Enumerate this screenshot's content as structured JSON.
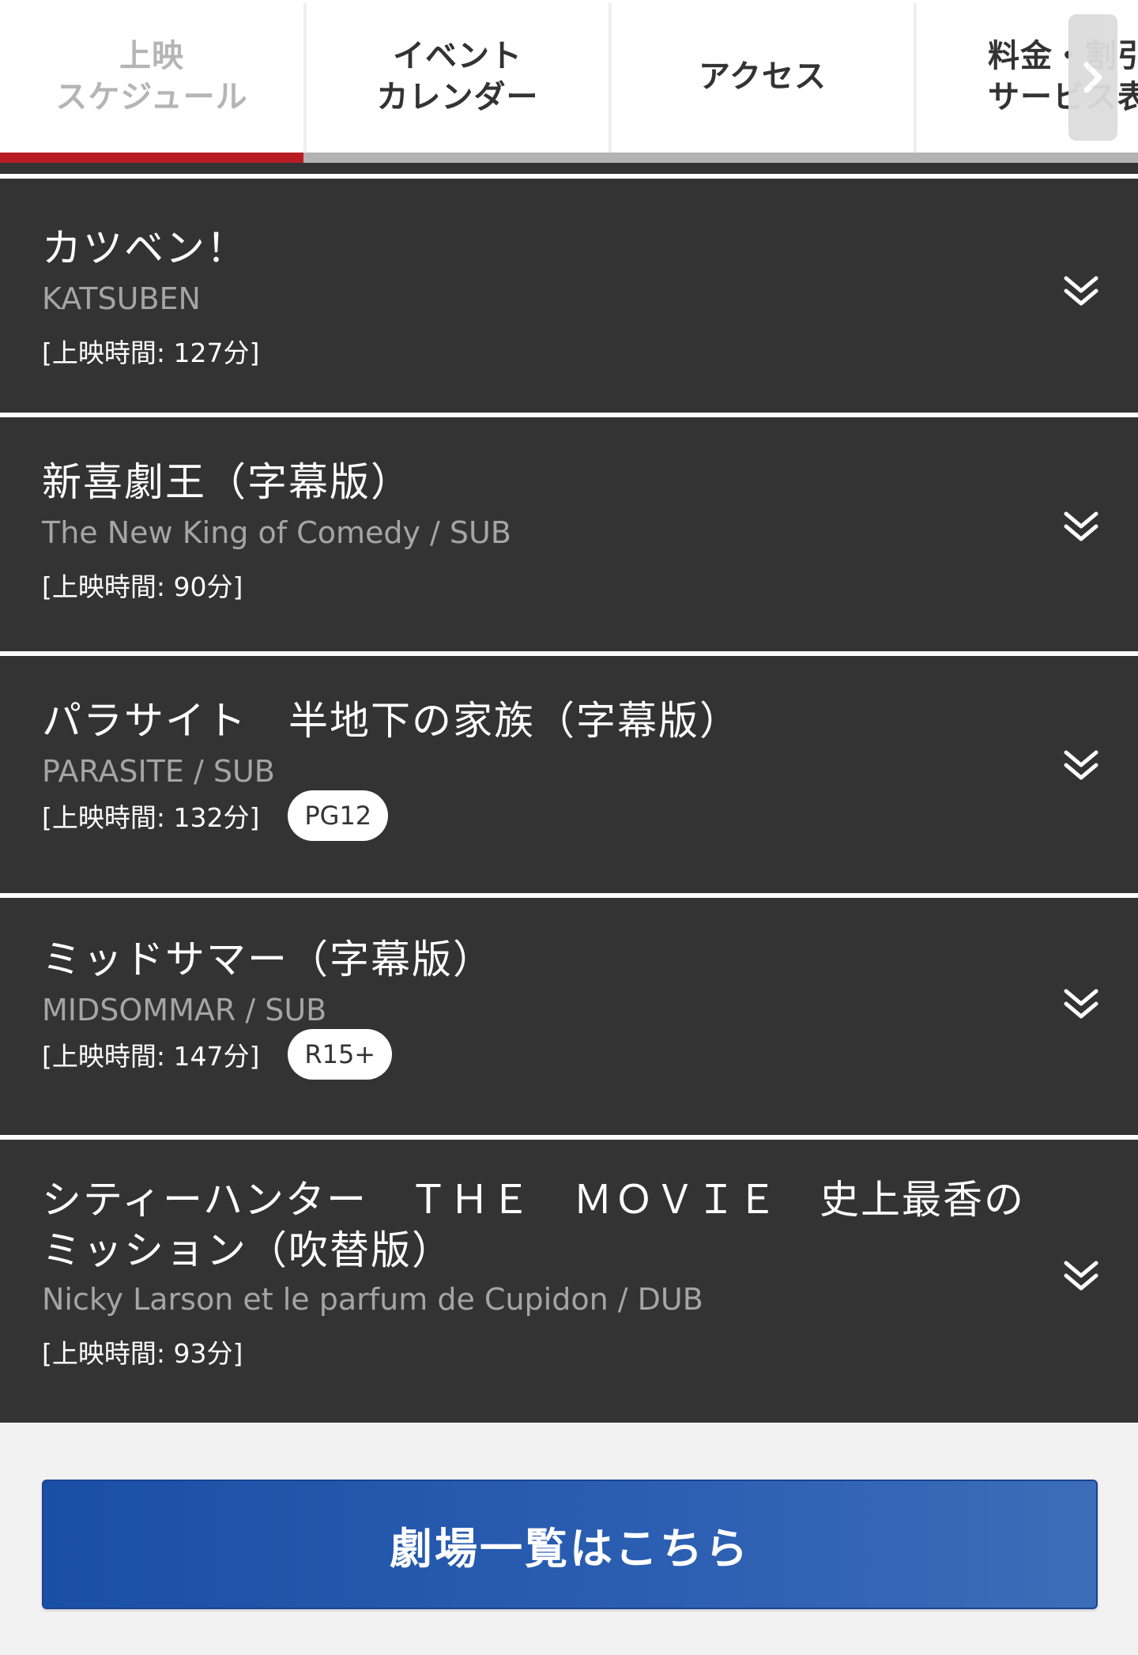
{
  "tabs": [
    {
      "label": "上映\nスケジュール",
      "active": true
    },
    {
      "label": "イベント\nカレンダー",
      "active": false
    },
    {
      "label": "アクセス",
      "active": false
    },
    {
      "label": "料金・割引\nサービス表",
      "active": false
    }
  ],
  "tabs_scroll_icon": "chevron-right-icon",
  "movies": [
    {
      "title": "カツベン！",
      "subtitle": "KATSUBEN",
      "runtime": "[上映時間: 127分]",
      "rating": null
    },
    {
      "title": "新喜劇王（字幕版）",
      "subtitle": "The New King of Comedy / SUB",
      "runtime": "[上映時間: 90分]",
      "rating": null
    },
    {
      "title": "パラサイト　半地下の家族（字幕版）",
      "subtitle": "PARASITE / SUB",
      "runtime": "[上映時間: 132分]",
      "rating": "PG12"
    },
    {
      "title": "ミッドサマー（字幕版）",
      "subtitle": "MIDSOMMAR / SUB",
      "runtime": "[上映時間: 147分]",
      "rating": "R15+"
    },
    {
      "title": "シティーハンター　ＴＨＥ　ＭＯＶＩＥ　史上最香のミッション（吹替版）",
      "subtitle": "Nicky Larson et le parfum de Cupidon / DUB",
      "runtime": "[上映時間: 93分]",
      "rating": null
    }
  ],
  "expand_icon": "double-chevron-down-icon",
  "theater_list_button": "劇場一覧はこちら",
  "colors": {
    "active_tab_underline": "#b81c22",
    "card_background": "#333333",
    "subtitle_text": "#a5a5a5",
    "button_blue": "#2c5fb2"
  }
}
